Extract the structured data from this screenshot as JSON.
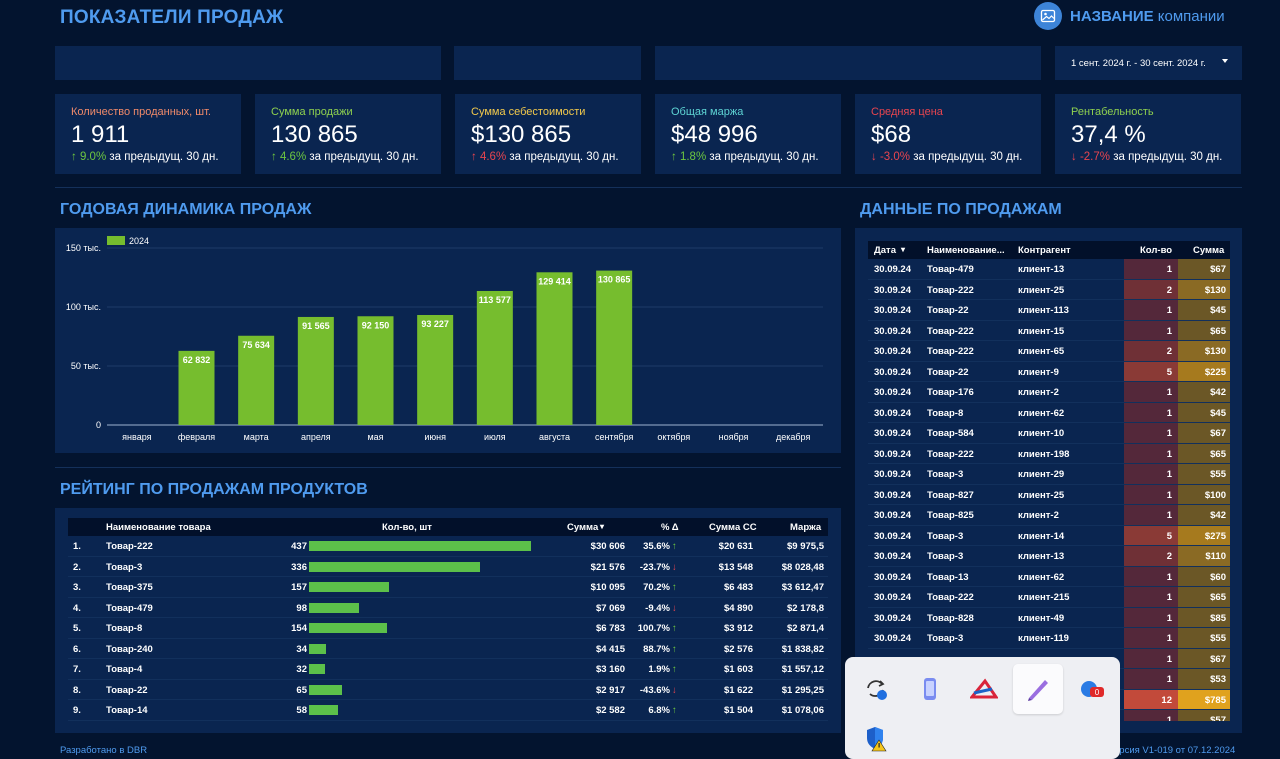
{
  "header": {
    "title": "ПОКАЗАТЕЛИ ПРОДАЖ",
    "company_bold": "НАЗВАНИЕ",
    "company_rest": "компании"
  },
  "date_range": "1 сент. 2024 г. - 30 сент. 2024 г.",
  "kpis": [
    {
      "label": "Количество проданных, шт.",
      "value": "1 911",
      "arrow": "↑",
      "pct": "9.0%",
      "suffix": "за предыдущ. 30 дн.",
      "color": "#f08a6a",
      "trend": "up"
    },
    {
      "label": "Сумма продажи",
      "value": "130 865",
      "arrow": "↑",
      "pct": "4.6%",
      "suffix": "за предыдущ. 30 дн.",
      "color": "#8fd14f",
      "trend": "up"
    },
    {
      "label": "Сумма себестоимости",
      "value": "$130 865",
      "arrow": "↑",
      "pct": "4.6%",
      "suffix": "за предыдущ. 30 дн.",
      "color": "#f2c94c",
      "trend": "upred"
    },
    {
      "label": "Общая маржа",
      "value": "$48 996",
      "arrow": "↑",
      "pct": "1.8%",
      "suffix": "за предыдущ. 30 дн.",
      "color": "#5ed4d4",
      "trend": "up"
    },
    {
      "label": "Средняя цена",
      "value": "$68",
      "arrow": "↓",
      "pct": "-3.0%",
      "suffix": "за предыдущ. 30 дн.",
      "color": "#e8454f",
      "trend": "down"
    },
    {
      "label": "Рентабельность",
      "value": "37,4 %",
      "arrow": "↓",
      "pct": "-2.7%",
      "suffix": "за предыдущ. 30 дн.",
      "color": "#8fd14f",
      "trend": "down"
    }
  ],
  "annual": {
    "title": "ГОДОВАЯ ДИНАМИКА ПРОДАЖ",
    "legend": "2024",
    "color": "#76bd2e"
  },
  "chart_data": {
    "type": "bar",
    "categories": [
      "января",
      "февраля",
      "марта",
      "апреля",
      "мая",
      "июня",
      "июля",
      "августа",
      "сентября",
      "октября",
      "ноября",
      "декабря"
    ],
    "series": [
      {
        "name": "2024",
        "values": [
          null,
          62832,
          75634,
          91565,
          92150,
          93227,
          113577,
          129414,
          130865,
          null,
          null,
          null
        ]
      }
    ],
    "data_labels": [
      "",
      "62 832",
      "75 634",
      "91 565",
      "92 150",
      "93 227",
      "113 577",
      "129 414",
      "130 865",
      "",
      "",
      ""
    ],
    "y_ticks": [
      0,
      50000,
      100000,
      150000
    ],
    "y_tick_labels": [
      "0",
      "50 тыс.",
      "100 тыс.",
      "150 тыс."
    ],
    "ylim": [
      0,
      150000
    ],
    "legend_position": "top-left",
    "grid": true
  },
  "rating": {
    "title": "РЕЙТИНГ ПО ПРОДАЖАМ ПРОДУКТОВ",
    "headers": {
      "name": "Наименование товара",
      "qty": "Кол-во, шт",
      "sum": "Сумма",
      "sort": "▾",
      "pct": "% Δ",
      "cost": "Сумма СС",
      "margin": "Маржа"
    },
    "rows": [
      {
        "n": "1.",
        "name": "Товар-222",
        "qty": 437,
        "sum": "$30 606",
        "pct": "35.6%",
        "arrow": "↑",
        "cost": "$20 631",
        "margin": "$9 975,5"
      },
      {
        "n": "2.",
        "name": "Товар-3",
        "qty": 336,
        "sum": "$21 576",
        "pct": "-23.7%",
        "arrow": "↓",
        "cost": "$13 548",
        "margin": "$8 028,48"
      },
      {
        "n": "3.",
        "name": "Товар-375",
        "qty": 157,
        "sum": "$10 095",
        "pct": "70.2%",
        "arrow": "↑",
        "cost": "$6 483",
        "margin": "$3 612,47"
      },
      {
        "n": "4.",
        "name": "Товар-479",
        "qty": 98,
        "sum": "$7 069",
        "pct": "-9.4%",
        "arrow": "↓",
        "cost": "$4 890",
        "margin": "$2 178,8"
      },
      {
        "n": "5.",
        "name": "Товар-8",
        "qty": 154,
        "sum": "$6 783",
        "pct": "100.7%",
        "arrow": "↑",
        "cost": "$3 912",
        "margin": "$2 871,4"
      },
      {
        "n": "6.",
        "name": "Товар-240",
        "qty": 34,
        "sum": "$4 415",
        "pct": "88.7%",
        "arrow": "↑",
        "cost": "$2 576",
        "margin": "$1 838,82"
      },
      {
        "n": "7.",
        "name": "Товар-4",
        "qty": 32,
        "sum": "$3 160",
        "pct": "1.9%",
        "arrow": "↑",
        "cost": "$1 603",
        "margin": "$1 557,12"
      },
      {
        "n": "8.",
        "name": "Товар-22",
        "qty": 65,
        "sum": "$2 917",
        "pct": "-43.6%",
        "arrow": "↓",
        "cost": "$1 622",
        "margin": "$1 295,25"
      },
      {
        "n": "9.",
        "name": "Товар-14",
        "qty": 58,
        "sum": "$2 582",
        "pct": "6.8%",
        "arrow": "↑",
        "cost": "$1 504",
        "margin": "$1 078,06"
      }
    ]
  },
  "sales": {
    "title": "ДАННЫЕ ПО ПРОДАЖАМ",
    "headers": {
      "date": "Дата",
      "sort": "▾",
      "name": "Наименование...",
      "client": "Контрагент",
      "qty": "Кол-во",
      "sum": "Сумма"
    },
    "rows": [
      {
        "date": "30.09.24",
        "name": "Товар-479",
        "client": "клиент-13",
        "qty": "1",
        "sum": "$67"
      },
      {
        "date": "30.09.24",
        "name": "Товар-222",
        "client": "клиент-25",
        "qty": "2",
        "sum": "$130"
      },
      {
        "date": "30.09.24",
        "name": "Товар-22",
        "client": "клиент-113",
        "qty": "1",
        "sum": "$45"
      },
      {
        "date": "30.09.24",
        "name": "Товар-222",
        "client": "клиент-15",
        "qty": "1",
        "sum": "$65"
      },
      {
        "date": "30.09.24",
        "name": "Товар-222",
        "client": "клиент-65",
        "qty": "2",
        "sum": "$130"
      },
      {
        "date": "30.09.24",
        "name": "Товар-22",
        "client": "клиент-9",
        "qty": "5",
        "sum": "$225"
      },
      {
        "date": "30.09.24",
        "name": "Товар-176",
        "client": "клиент-2",
        "qty": "1",
        "sum": "$42"
      },
      {
        "date": "30.09.24",
        "name": "Товар-8",
        "client": "клиент-62",
        "qty": "1",
        "sum": "$45"
      },
      {
        "date": "30.09.24",
        "name": "Товар-584",
        "client": "клиент-10",
        "qty": "1",
        "sum": "$67"
      },
      {
        "date": "30.09.24",
        "name": "Товар-222",
        "client": "клиент-198",
        "qty": "1",
        "sum": "$65"
      },
      {
        "date": "30.09.24",
        "name": "Товар-3",
        "client": "клиент-29",
        "qty": "1",
        "sum": "$55"
      },
      {
        "date": "30.09.24",
        "name": "Товар-827",
        "client": "клиент-25",
        "qty": "1",
        "sum": "$100"
      },
      {
        "date": "30.09.24",
        "name": "Товар-825",
        "client": "клиент-2",
        "qty": "1",
        "sum": "$42"
      },
      {
        "date": "30.09.24",
        "name": "Товар-3",
        "client": "клиент-14",
        "qty": "5",
        "sum": "$275"
      },
      {
        "date": "30.09.24",
        "name": "Товар-3",
        "client": "клиент-13",
        "qty": "2",
        "sum": "$110"
      },
      {
        "date": "30.09.24",
        "name": "Товар-13",
        "client": "клиент-62",
        "qty": "1",
        "sum": "$60"
      },
      {
        "date": "30.09.24",
        "name": "Товар-222",
        "client": "клиент-215",
        "qty": "1",
        "sum": "$65"
      },
      {
        "date": "30.09.24",
        "name": "Товар-828",
        "client": "клиент-49",
        "qty": "1",
        "sum": "$85"
      },
      {
        "date": "30.09.24",
        "name": "Товар-3",
        "client": "клиент-119",
        "qty": "1",
        "sum": "$55"
      },
      {
        "date": "",
        "name": "",
        "client": "",
        "qty": "1",
        "sum": "$67"
      },
      {
        "date": "",
        "name": "",
        "client": "",
        "qty": "1",
        "sum": "$53"
      },
      {
        "date": "",
        "name": "",
        "client": "",
        "qty": "12",
        "sum": "$785"
      },
      {
        "date": "",
        "name": "",
        "client": "",
        "qty": "1",
        "sum": "$57"
      }
    ]
  },
  "footer": {
    "left": "Разработано в DBR",
    "right": "ерсия V1-019 от 07.12.2024"
  },
  "tray": {
    "icons": [
      "sync-icon",
      "phone-link-icon",
      "autodesk-icon",
      "pen-icon",
      "notification-badge-icon",
      "security-shield-icon"
    ],
    "badge_text": "0"
  }
}
